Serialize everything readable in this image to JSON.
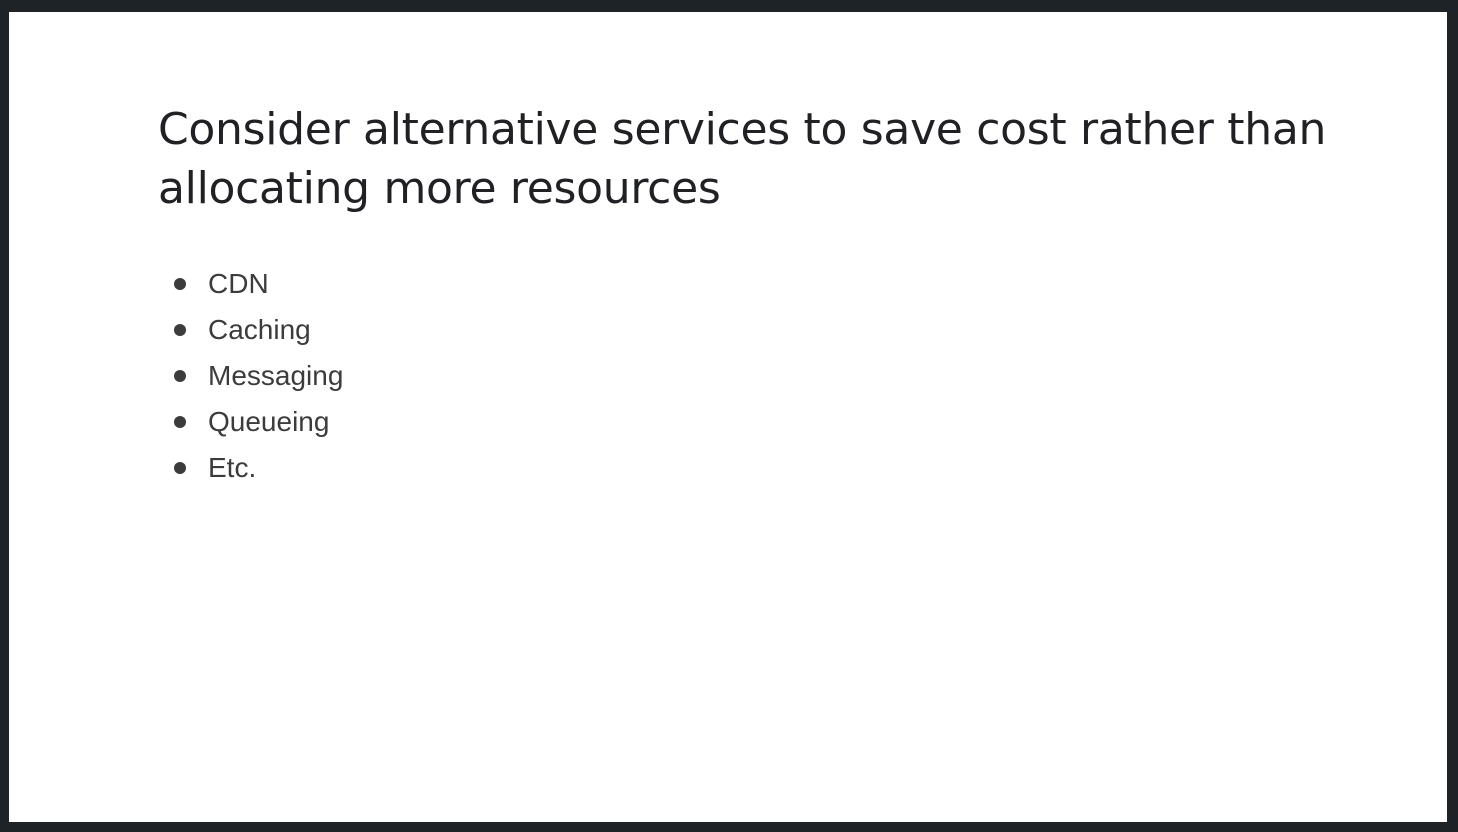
{
  "slide": {
    "title": "Consider alternative services to save cost rather than allocating more resources",
    "bullets": [
      {
        "label": "CDN"
      },
      {
        "label": "Caching"
      },
      {
        "label": "Messaging"
      },
      {
        "label": "Queueing"
      },
      {
        "label": "Etc."
      }
    ]
  },
  "colors": {
    "frame": "#1e2328",
    "slide_background": "#ffffff",
    "title_text": "#202124",
    "body_text": "#3c3c3c"
  }
}
